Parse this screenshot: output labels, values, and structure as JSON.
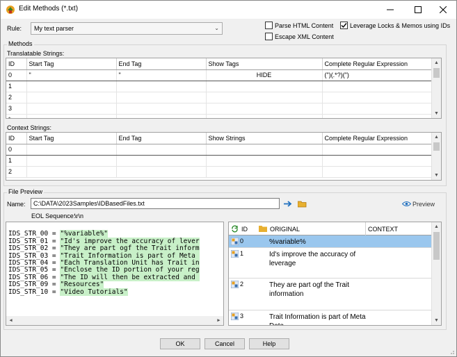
{
  "window": {
    "title": "Edit Methods (*.txt)"
  },
  "rule": {
    "label": "Rule:",
    "value": "My text parser"
  },
  "options": {
    "parse_html": {
      "label": "Parse HTML Content",
      "checked": false
    },
    "escape_xml": {
      "label": "Escape XML Content",
      "checked": false
    },
    "leverage": {
      "label": "Leverage Locks & Memos using IDs",
      "checked": true
    }
  },
  "methods": {
    "group_label": "Methods",
    "translatable_label": "Translatable Strings:",
    "context_label": "Context Strings:",
    "translatable_columns": [
      "ID",
      "Start Tag",
      "End Tag",
      "Show Tags",
      "Complete Regular Expression"
    ],
    "context_columns": [
      "ID",
      "Start Tag",
      "End Tag",
      "Show Strings",
      "Complete Regular Expression"
    ],
    "translatable_rows": [
      {
        "id": "0",
        "start": "\"",
        "end": "\"",
        "show": "HIDE",
        "regex": "(\")(.*?)(\")"
      },
      {
        "id": "1",
        "start": "",
        "end": "",
        "show": "",
        "regex": ""
      },
      {
        "id": "2",
        "start": "",
        "end": "",
        "show": "",
        "regex": ""
      },
      {
        "id": "3",
        "start": "",
        "end": "",
        "show": "",
        "regex": ""
      },
      {
        "id": "*",
        "start": "",
        "end": "",
        "show": "",
        "regex": ""
      }
    ],
    "context_rows": [
      {
        "id": "0"
      },
      {
        "id": "1"
      },
      {
        "id": "2"
      }
    ]
  },
  "preview": {
    "group_label": "File Preview",
    "name_label": "Name:",
    "file_path": "C:\\DATA\\2023Samples\\IDBasedFiles.txt",
    "eol_label": "EOL Sequence:",
    "eol_value": "\\r\\n",
    "preview_button": "Preview",
    "code_lines": [
      {
        "key": "IDS_STR_00",
        "sep": " = ",
        "value": "\"%variable%\""
      },
      {
        "key": "IDS_STR_01",
        "sep": " = ",
        "value": "\"Id's improve the accuracy of lever"
      },
      {
        "key": "IDS_STR_02",
        "sep": " = ",
        "value": "\"They are part ogf the Trait inform"
      },
      {
        "key": "IDS_STR_03",
        "sep": " = ",
        "value": "\"Trait Information is part of Meta "
      },
      {
        "key": "IDS_STR_04",
        "sep": " = ",
        "value": "\"Each Translation Unit has Trait in"
      },
      {
        "key": "IDS_STR_05",
        "sep": " = ",
        "value": "\"Enclose the ID portion of your reg"
      },
      {
        "key": "IDS_STR_06",
        "sep": " = ",
        "value": "\"The ID will then be extracted and "
      },
      {
        "key": "IDS_STR_09",
        "sep": " = ",
        "value": "\"Resources\""
      },
      {
        "key": "IDS_STR_10",
        "sep": " = ",
        "value": "\"Video Tutorials\""
      }
    ],
    "trans_columns": {
      "id": "ID",
      "original": "ORIGINAL",
      "context": "CONTEXT"
    },
    "trans_rows": [
      {
        "id": "0",
        "text": "%variable%"
      },
      {
        "id": "1",
        "text": "Id's improve the accuracy of leverage"
      },
      {
        "id": "2",
        "text": "They are part ogf the Trait information"
      },
      {
        "id": "3",
        "text": "Trait Information is part of Meta Data"
      }
    ]
  },
  "buttons": {
    "ok": "OK",
    "cancel": "Cancel",
    "help": "Help"
  },
  "colors": {
    "selection": "#9ac7ee",
    "highlight": "#c8f0c8",
    "quote": "#c00000",
    "accent": "#1f6fbf"
  }
}
